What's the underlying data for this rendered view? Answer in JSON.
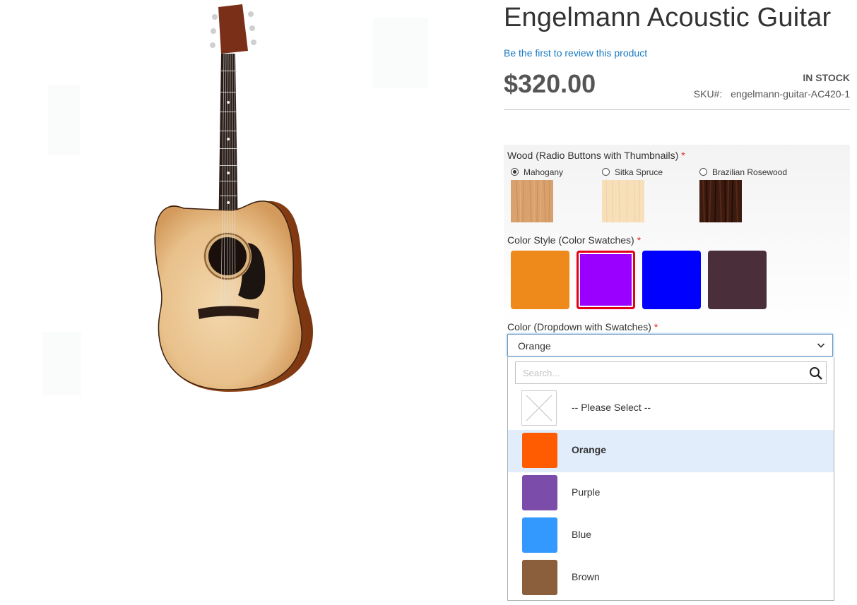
{
  "product": {
    "title": "Engelmann Acoustic Guitar",
    "review_link": "Be the first to review this product",
    "price": "$320.00",
    "stock": "IN STOCK",
    "sku_label": "SKU#:",
    "sku_value": "engelmann-guitar-AC420-1"
  },
  "options": {
    "wood": {
      "label": "Wood (Radio Buttons with Thumbnails)",
      "required_mark": "*",
      "choices": [
        {
          "label": "Mahogany",
          "checked": true
        },
        {
          "label": "Sitka Spruce",
          "checked": false
        },
        {
          "label": "Brazilian Rosewood",
          "checked": false
        }
      ]
    },
    "color_style": {
      "label": "Color Style (Color Swatches)",
      "required_mark": "*",
      "swatches": [
        {
          "color": "#ee891b",
          "selected": false
        },
        {
          "color": "#9900ff",
          "selected": true
        },
        {
          "color": "#0000ff",
          "selected": false
        },
        {
          "color": "#4a2f3a",
          "selected": false
        }
      ]
    },
    "color_dropdown": {
      "label": "Color (Dropdown with Swatches)",
      "required_mark": "*",
      "selected": "Orange",
      "search_placeholder": "Search...",
      "items": [
        {
          "label": "-- Please Select --",
          "color": null,
          "active": false
        },
        {
          "label": "Orange",
          "color": "#ff5b00",
          "active": true
        },
        {
          "label": "Purple",
          "color": "#7b4ca9",
          "active": false
        },
        {
          "label": "Blue",
          "color": "#3399ff",
          "active": false
        },
        {
          "label": "Brown",
          "color": "#8b5e3c",
          "active": false
        }
      ]
    }
  }
}
